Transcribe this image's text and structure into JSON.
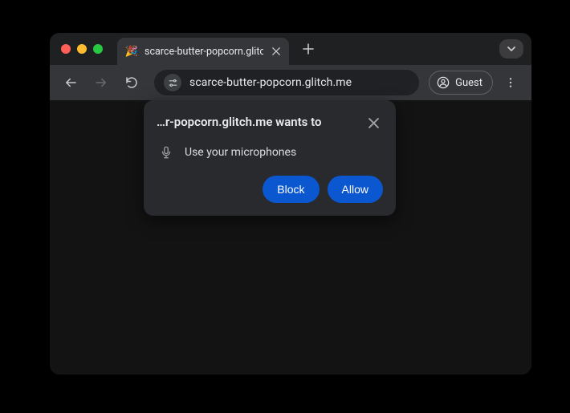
{
  "tab": {
    "title": "scarce-butter-popcorn.glitch",
    "favicon_emoji": "🎉"
  },
  "omnibox": {
    "url": "scarce-butter-popcorn.glitch.me"
  },
  "profile": {
    "label": "Guest"
  },
  "permission": {
    "title": "…r-popcorn.glitch.me wants to",
    "request": "Use your microphones",
    "block_label": "Block",
    "allow_label": "Allow"
  }
}
